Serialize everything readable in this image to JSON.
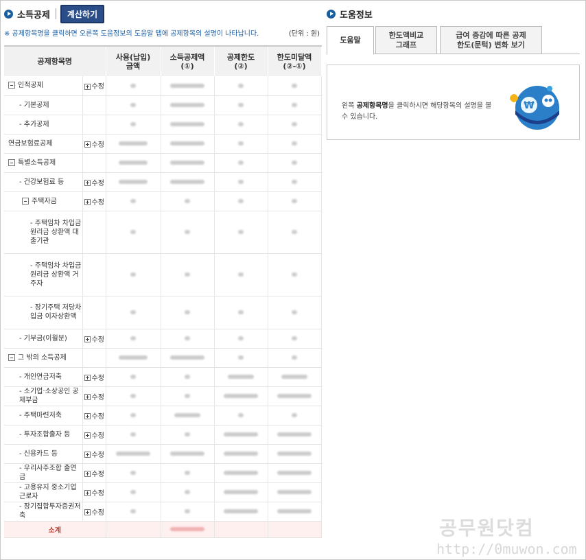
{
  "left": {
    "title": "소득공제",
    "calc_button": "계산하기",
    "notice": "※ 공제항목명을 클릭하면 오른쪽 도움정보의 도움말 탭에 공제항목의 설명이 나타납니다.",
    "unit": "(단위 : 원)"
  },
  "table": {
    "headers": [
      "공제항목명",
      "사용(납입)\n금액",
      "소득공제액\n(①)",
      "공제한도\n(②)",
      "한도미달액\n(②-①)"
    ],
    "edit_label": "수정",
    "rows": [
      {
        "name": "인적공제"
      },
      {
        "name": "- 기본공제"
      },
      {
        "name": "- 추가공제"
      },
      {
        "name": "연금보험료공제"
      },
      {
        "name": "특별소득공제"
      },
      {
        "name": "- 건강보험료 등"
      },
      {
        "name": "주택자금"
      },
      {
        "name": "- 주택임차 차입금 원리금 상환액 대출기관"
      },
      {
        "name": "- 주택임차 차입금 원리금 상환액 거주자"
      },
      {
        "name": "- 장기주택 저당차입금 이자상환액"
      },
      {
        "name": "- 기부금(이월분)"
      },
      {
        "name": "그 밖의 소득공제"
      },
      {
        "name": "- 개인연금저축"
      },
      {
        "name": "- 소기업·소상공인 공제부금"
      },
      {
        "name": "- 주택마련저축"
      },
      {
        "name": "- 투자조합출자 등"
      },
      {
        "name": "- 신용카드 등"
      },
      {
        "name": "- 우리사주조합 출연금"
      },
      {
        "name": "- 고용유지 중소기업 근로자"
      },
      {
        "name": "- 장기집합투자증권저축"
      }
    ],
    "subtotal": "소계"
  },
  "right": {
    "title": "도움정보",
    "tabs": [
      "도움말",
      "한도액비교\n그래프",
      "급여 증감에 따른 공제\n한도(문턱) 변화 보기"
    ],
    "help_text_bold": "공제항목명",
    "help_text_before": "왼쪽 ",
    "help_text_after": "을 클릭하시면 해당항목의 설명을 볼 수 있습니다."
  },
  "watermark": {
    "text": "공무원닷컴",
    "url": "http://0muwon.com"
  }
}
